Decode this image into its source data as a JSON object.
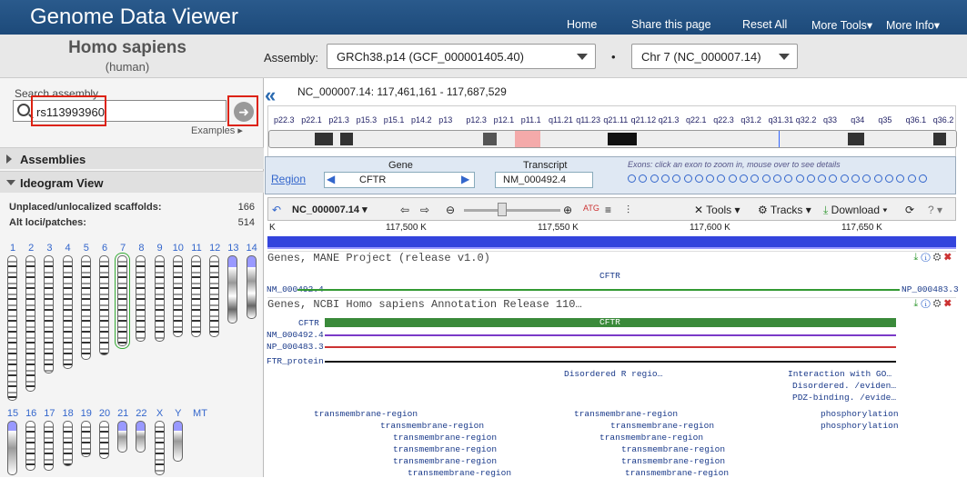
{
  "header": {
    "title": "Genome Data Viewer",
    "nav": [
      "Home",
      "Share this page",
      "Reset All",
      "More Tools▾",
      "More Info▾"
    ]
  },
  "organism": {
    "name": "Homo sapiens",
    "common": "(human)"
  },
  "assembly": {
    "label": "Assembly:",
    "value": "GRCh38.p14 (GCF_000001405.40)",
    "dot": "•",
    "chrom": "Chr 7 (NC_000007.14)"
  },
  "search": {
    "label": "Search assembly",
    "value": "rs113993960",
    "examples": "Examples ▸"
  },
  "sections": {
    "assemblies": "Assemblies",
    "ideogram": "Ideogram View"
  },
  "stats": [
    {
      "label": "Unplaced/unlocalized scaffolds:",
      "value": "166"
    },
    {
      "label": "Alt loci/patches:",
      "value": "514"
    }
  ],
  "chromosomes_row1": [
    "1",
    "2",
    "3",
    "4",
    "5",
    "6",
    "7",
    "8",
    "9",
    "10",
    "11",
    "12",
    "13",
    "14"
  ],
  "chromosomes_row2": [
    "15",
    "16",
    "17",
    "18",
    "19",
    "20",
    "21",
    "22",
    "X",
    "Y",
    "MT"
  ],
  "location": {
    "text": "NC_000007.14:  117,461,161 - 117,687,529"
  },
  "bands": [
    "p22.3",
    "p22.1",
    "p21.3",
    "p15.3",
    "p15.1",
    "p14.2",
    "p13",
    "p12.3",
    "p12.1",
    "p11.1",
    "q11.21",
    "q11.23",
    "q21.11",
    "q21.12",
    "q21.3",
    "q22.1",
    "q22.3",
    "q31.2",
    "q31.31",
    "q32.2",
    "q33",
    "q34",
    "q35",
    "q36.1",
    "q36.2"
  ],
  "rail": {
    "region": "Region",
    "gene_label": "Gene",
    "gene": "CFTR",
    "transcript_label": "Transcript",
    "transcript": "NM_000492.4",
    "exons_hint": "Exons: click an exon to zoom in, mouse over to see details"
  },
  "toolbar": {
    "seq": "NC_000007.14",
    "tools": "Tools",
    "tracks": "Tracks",
    "download": "Download",
    "help": "?"
  },
  "ruler": [
    "K",
    "117,500 K",
    "117,550 K",
    "117,600 K",
    "117,650 K"
  ],
  "tracks": {
    "mane": "Genes, MANE Project (release v1.0)",
    "ncbi": "Genes, NCBI Homo sapiens Annotation Release 110…"
  },
  "features": {
    "cftr": "CFTR",
    "nm": "NM_000492.4",
    "np": "NP_000483.3",
    "nm_trunc": "NM_000492.4",
    "np_trunc": "NP_000483.3",
    "ftr": "FTR_protein",
    "dis_r": "Disordered R regio…",
    "inter": "Interaction with GO…",
    "dis2": "Disordered. /eviden…",
    "pdz": "PDZ-binding. /evide…",
    "tm": "transmembrane-region",
    "phos": "phosphorylation"
  }
}
